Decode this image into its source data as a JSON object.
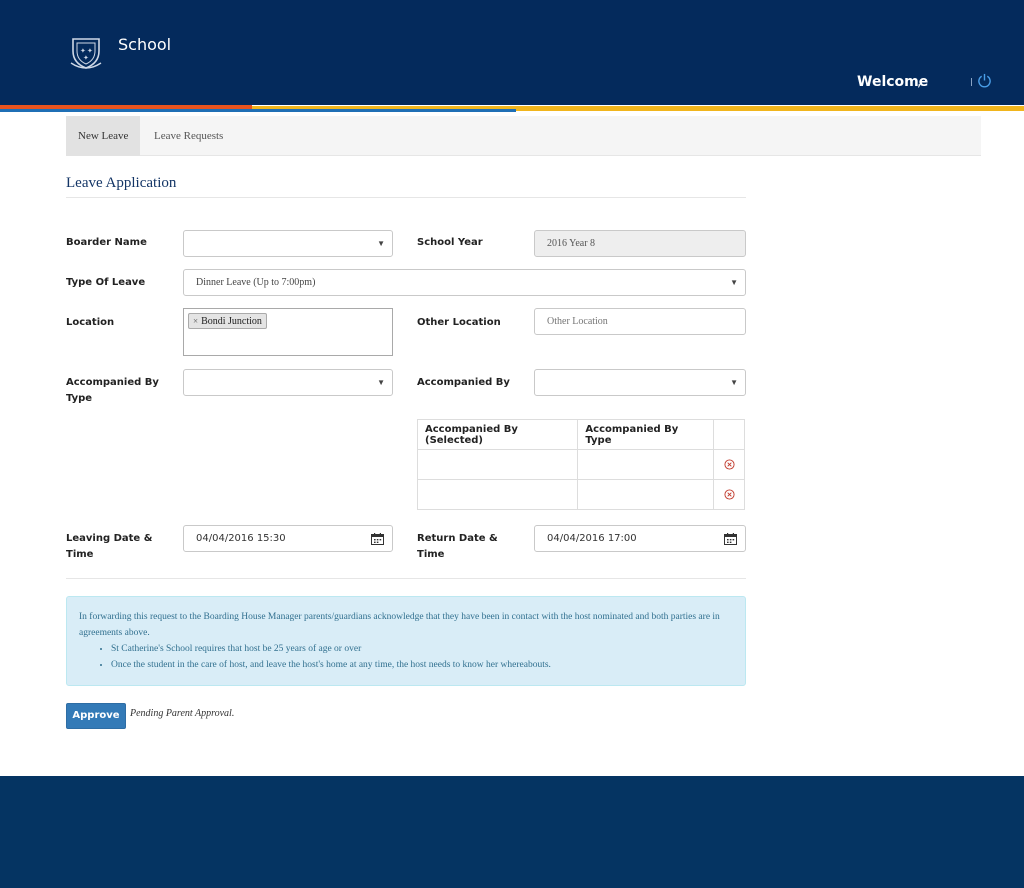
{
  "header": {
    "brand": "School",
    "welcome": "Welcome",
    "welcome_suffix": ",",
    "logo_icon": "school-crest-icon",
    "logout_icon": "power-icon",
    "colors": {
      "navy": "#042a5c",
      "orange": "#e8531e",
      "gold": "#f1b51c",
      "blue": "#1f6fb5"
    }
  },
  "tabs": [
    {
      "label": "New Leave",
      "active": true
    },
    {
      "label": "Leave Requests",
      "active": false
    }
  ],
  "form": {
    "title": "Leave Application",
    "boarder_name": {
      "label": "Boarder Name",
      "value": ""
    },
    "school_year": {
      "label": "School Year",
      "value": "2016 Year 8"
    },
    "type_of_leave": {
      "label": "Type Of Leave",
      "value": "Dinner Leave (Up to 7:00pm)"
    },
    "location": {
      "label": "Location",
      "tokens": [
        "Bondi Junction"
      ]
    },
    "other_location": {
      "label": "Other Location",
      "placeholder": "Other Location",
      "value": ""
    },
    "accompanied_type": {
      "label_line1": "Accompanied By",
      "label_line2": "Type",
      "value": ""
    },
    "accompanied_by": {
      "label": "Accompanied By",
      "value": ""
    },
    "accompanied_table": {
      "headers": [
        "Accompanied By (Selected)",
        "Accompanied By Type",
        ""
      ],
      "rows": [
        {
          "selected": "",
          "type": ""
        },
        {
          "selected": "",
          "type": ""
        }
      ]
    },
    "leaving": {
      "label_line1": "Leaving Date &",
      "label_line2": "Time",
      "value": "04/04/2016 15:30"
    },
    "return": {
      "label_line1": "Return Date &",
      "label_line2": "Time",
      "value": "04/04/2016 17:00"
    }
  },
  "notice": {
    "intro": "In forwarding this request to the Boarding House Manager parents/guardians acknowledge that they have been in contact with the host nominated and both parties are in agreements above.",
    "bullets": [
      "St Catherine's School requires that host be 25 years of age or over",
      "Once the student in the care of host, and leave the host's home at any time, the host needs to know her whereabouts."
    ]
  },
  "actions": {
    "approve_label": "Approve",
    "status": "Pending Parent Approval."
  }
}
